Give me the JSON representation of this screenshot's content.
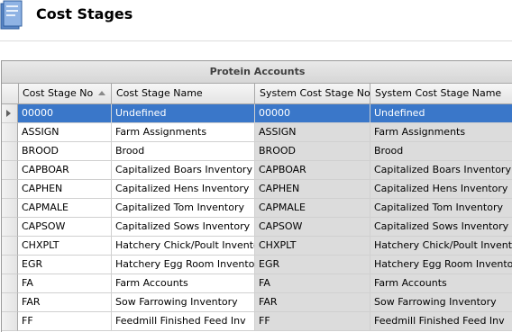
{
  "page": {
    "title": "Cost Stages"
  },
  "grid": {
    "group_header": "Protein Accounts",
    "columns": [
      "Cost Stage No",
      "Cost Stage Name",
      "System Cost Stage No",
      "System Cost Stage Name"
    ],
    "rows": [
      [
        "00000",
        "Undefined",
        "00000",
        "Undefined"
      ],
      [
        "ASSIGN",
        "Farm Assignments",
        "ASSIGN",
        "Farm Assignments"
      ],
      [
        "BROOD",
        "Brood",
        "BROOD",
        "Brood"
      ],
      [
        "CAPBOAR",
        "Capitalized Boars Inventory",
        "CAPBOAR",
        "Capitalized Boars Inventory"
      ],
      [
        "CAPHEN",
        "Capitalized Hens Inventory",
        "CAPHEN",
        "Capitalized Hens Inventory"
      ],
      [
        "CAPMALE",
        "Capitalized Tom Inventory",
        "CAPMALE",
        "Capitalized Tom Inventory"
      ],
      [
        "CAPSOW",
        "Capitalized Sows Inventory",
        "CAPSOW",
        "Capitalized Sows Inventory"
      ],
      [
        "CHXPLT",
        "Hatchery Chick/Poult Inventory",
        "CHXPLT",
        "Hatchery Chick/Poult Inventory"
      ],
      [
        "EGR",
        "Hatchery Egg Room Inventory",
        "EGR",
        "Hatchery Egg Room Inventory"
      ],
      [
        "FA",
        "Farm Accounts",
        "FA",
        "Farm Accounts"
      ],
      [
        "FAR",
        "Sow Farrowing Inventory",
        "FAR",
        "Sow Farrowing Inventory"
      ],
      [
        "FF",
        "Feedmill Finished Feed Inv",
        "FF",
        "Feedmill Finished Feed Inv"
      ]
    ],
    "selected_row": 0,
    "sorted_column": "Cost Stage No",
    "sort_direction": "ascending"
  },
  "colors": {
    "selection": "#3a77c9",
    "readonly_cell": "#dcdcdc"
  },
  "icons": {
    "page_icon": "document-stack-icon",
    "row_indicator": "current-row-arrow-icon",
    "sort_indicator": "sort-ascending-icon"
  }
}
